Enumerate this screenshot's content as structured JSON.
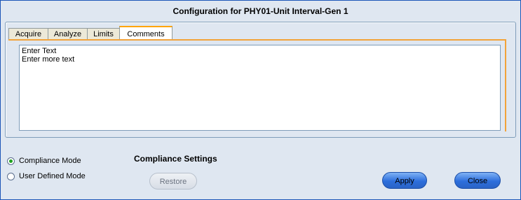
{
  "window": {
    "title": "Configuration for PHY01-Unit Interval-Gen 1"
  },
  "tabs": [
    {
      "label": "Acquire",
      "active": false
    },
    {
      "label": "Analyze",
      "active": false
    },
    {
      "label": "Limits",
      "active": false
    },
    {
      "label": "Comments",
      "active": true
    }
  ],
  "comments": {
    "lines": [
      "Enter Text",
      "Enter more text"
    ]
  },
  "modes": [
    {
      "label": "Compliance Mode",
      "selected": true
    },
    {
      "label": "User Defined Mode",
      "selected": false
    }
  ],
  "compliance_settings": {
    "title": "Compliance Settings",
    "restore_label": "Restore"
  },
  "footer": {
    "apply_label": "Apply",
    "close_label": "Close"
  },
  "colors": {
    "active_tab_accent": "#f2a33a",
    "button_blue": "#2d6fdc",
    "radio_selected": "#21a121"
  }
}
